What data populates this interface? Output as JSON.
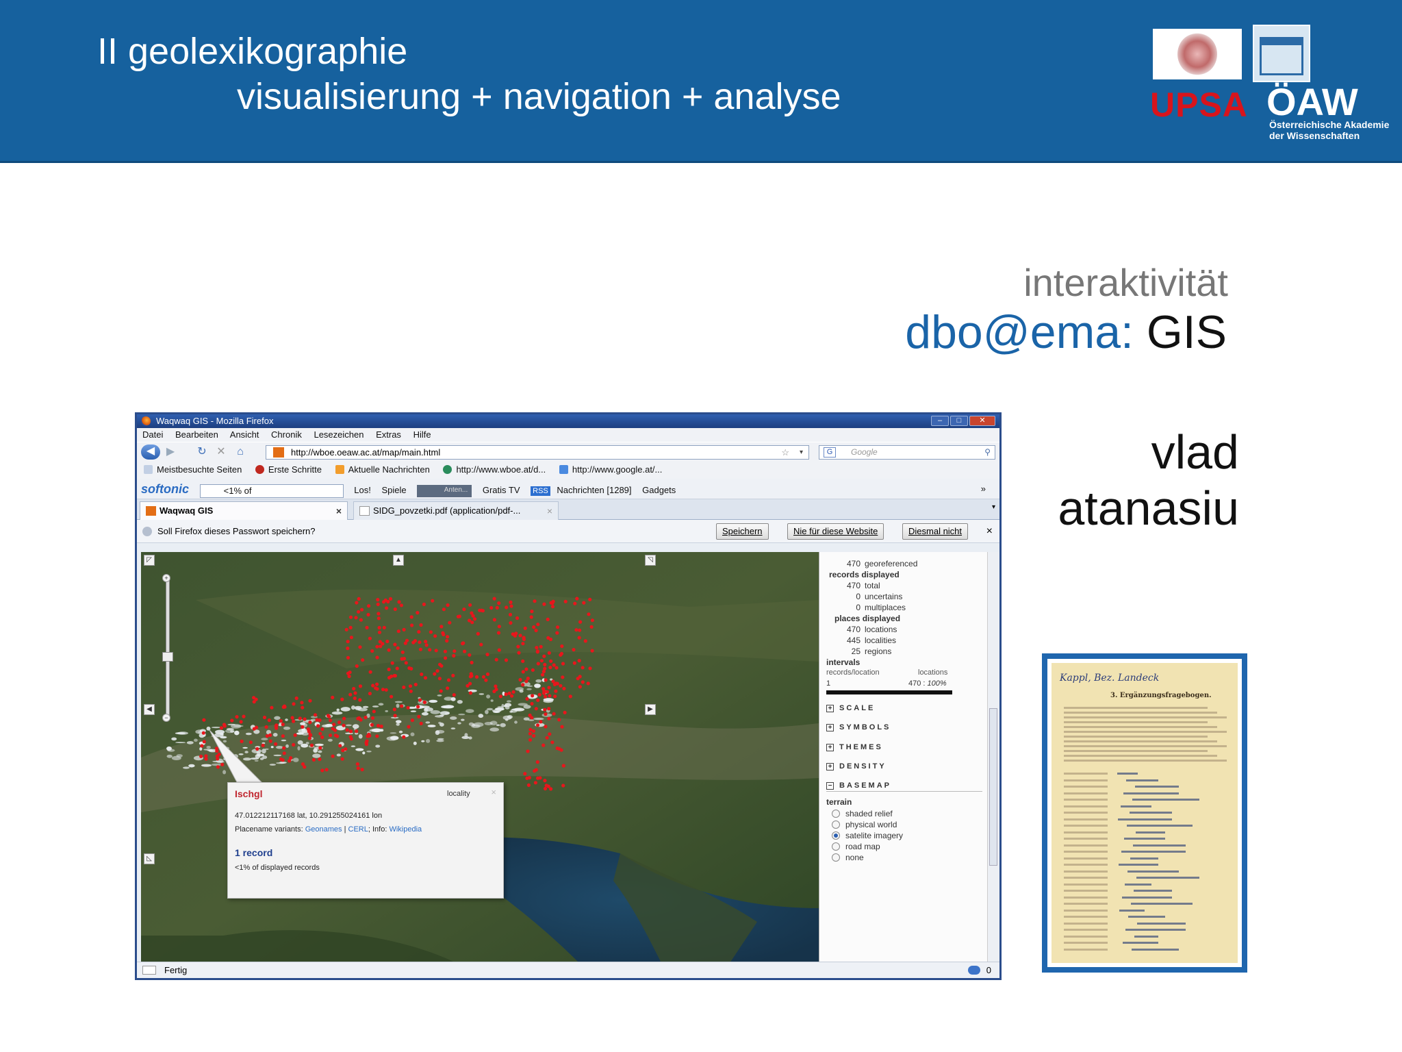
{
  "slide": {
    "title_line1": "II geolexikographie",
    "title_line2": "visualisierung + navigation + analyse",
    "upsa_label": "UPSA",
    "oaw_label": "ÖAW",
    "oaw_sub1": "Österreichische Akademie",
    "oaw_sub2": "der Wissenschaften",
    "interaktivitaet": "interaktivität",
    "dbo_prefix": "dbo@ema:",
    "dbo_suffix": "GIS",
    "author_first": "vlad",
    "author_last": "atanasiu"
  },
  "document": {
    "handwritten_header": "Kappl, Bez. Landeck",
    "printed_heading": "3. Ergänzungsfragebogen."
  },
  "browser": {
    "window_title": "Waqwaq GIS - Mozilla Firefox",
    "menu": [
      "Datei",
      "Bearbeiten",
      "Ansicht",
      "Chronik",
      "Lesezeichen",
      "Extras",
      "Hilfe"
    ],
    "url": "http://wboe.oeaw.ac.at/map/main.html",
    "search_placeholder": "Google",
    "bookmarks": [
      "Meistbesuchte Seiten",
      "Erste Schritte",
      "Aktuelle Nachrichten",
      "http://www.wboe.at/d...",
      "http://www.google.at/..."
    ],
    "toolbar": {
      "brand": "softonic",
      "search_value": "<1% of",
      "go": "Los!",
      "games": "Spiele",
      "radio": "Anten...",
      "tv": "Gratis TV",
      "rss": "RSS",
      "news": "Nachrichten [1289]",
      "gadgets": "Gadgets"
    },
    "tabs": [
      {
        "label": "Waqwaq GIS",
        "active": true
      },
      {
        "label": "SIDG_povzetki.pdf (application/pdf-...",
        "active": false
      }
    ],
    "password_bar": {
      "message": "Soll Firefox dieses Passwort speichern?",
      "save": "Speichern",
      "never": "Nie für diese Website",
      "not_now": "Diesmal nicht"
    },
    "status": "Fertig",
    "status_count": "0"
  },
  "popup": {
    "place": "Ischgl",
    "type": "locality",
    "coords": "47.012212117168 lat, 10.291255024161 lon",
    "variants_label": "Placename variants:",
    "variant_links": [
      "Geonames",
      "CERL"
    ],
    "info_label": "Info:",
    "info_link": "Wikipedia",
    "records": "1 record",
    "share": "<1% of displayed records"
  },
  "panel": {
    "georef_num": "470",
    "georef_label": "georeferenced",
    "records_displayed": "records displayed",
    "total_num": "470",
    "total_label": "total",
    "uncertains_num": "0",
    "uncertains_label": "uncertains",
    "multiplaces_num": "0",
    "multiplaces_label": "multiplaces",
    "places_displayed": "places displayed",
    "locations_num": "470",
    "locations_label": "locations",
    "localities_num": "445",
    "localities_label": "localities",
    "regions_num": "25",
    "regions_label": "regions",
    "intervals": "intervals",
    "col1": "records/location",
    "col2": "locations",
    "row_val": "1",
    "row_count": "470",
    "row_pct": "100%",
    "sections": [
      "SCALE",
      "SYMBOLS",
      "THEMES",
      "DENSITY",
      "BASEMAP"
    ],
    "basemap_group": "terrain",
    "basemap_options": [
      "shaded relief",
      "physical world",
      "satelite imagery",
      "road map",
      "none"
    ],
    "basemap_selected": 2
  },
  "colors": {
    "header_blue": "#16619e",
    "upsa_red": "#d8141c",
    "marker_red": "#e8161c",
    "link_blue": "#2a6cc4"
  }
}
